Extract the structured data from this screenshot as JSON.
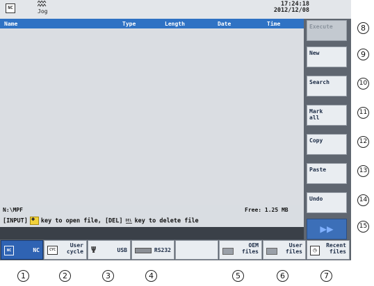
{
  "header": {
    "nc_icon": "NC",
    "mode_label": "Jog",
    "time": "17:24:18",
    "date": "2012/12/08"
  },
  "list": {
    "columns": [
      "Name",
      "Type",
      "Length",
      "Date",
      "Time"
    ]
  },
  "footer": {
    "path": "N:\\MPF",
    "free": "Free: 1.25 MB",
    "hint_part1": "[INPUT]",
    "hint_part2": "key to open file, [DEL]",
    "hint_del": "DEL",
    "hint_part3": "key to delete file"
  },
  "vertical_softkeys": [
    {
      "label": "Execute",
      "enabled": false
    },
    {
      "label": "New",
      "enabled": true
    },
    {
      "label": "Search",
      "enabled": true
    },
    {
      "label": "Mark\nall",
      "enabled": true
    },
    {
      "label": "Copy",
      "enabled": true
    },
    {
      "label": "Paste",
      "enabled": true
    },
    {
      "label": "Undo",
      "enabled": true
    },
    {
      "label": "▶▶",
      "enabled": true
    }
  ],
  "horizontal_softkeys": [
    {
      "label": "NC",
      "icon": "nc-icon",
      "icon_text": "NC",
      "active": true
    },
    {
      "label": "User\ncycle",
      "icon": "cycle-icon",
      "icon_text": "CYC",
      "active": false
    },
    {
      "label": "USB",
      "icon": "usb-icon",
      "icon_text": "Ψ",
      "active": false
    },
    {
      "label": "RS232",
      "icon": "rs232-icon",
      "icon_text": "",
      "active": false
    },
    {
      "label": "",
      "icon": "",
      "icon_text": "",
      "active": false
    },
    {
      "label": "OEM\nfiles",
      "icon": "folder-icon",
      "icon_text": "",
      "active": false
    },
    {
      "label": "User\nfiles",
      "icon": "folder-icon",
      "icon_text": "",
      "active": false
    },
    {
      "label": "Recent\nfiles",
      "icon": "recent-icon",
      "icon_text": "◷",
      "active": false
    }
  ],
  "callouts": {
    "bottom": [
      "1",
      "2",
      "3",
      "4",
      "5",
      "6",
      "7"
    ],
    "right": [
      "8",
      "9",
      "10",
      "11",
      "12",
      "13",
      "14",
      "15"
    ]
  },
  "colors": {
    "header_blue": "#2f72c4",
    "active_key": "#2f63b3"
  }
}
